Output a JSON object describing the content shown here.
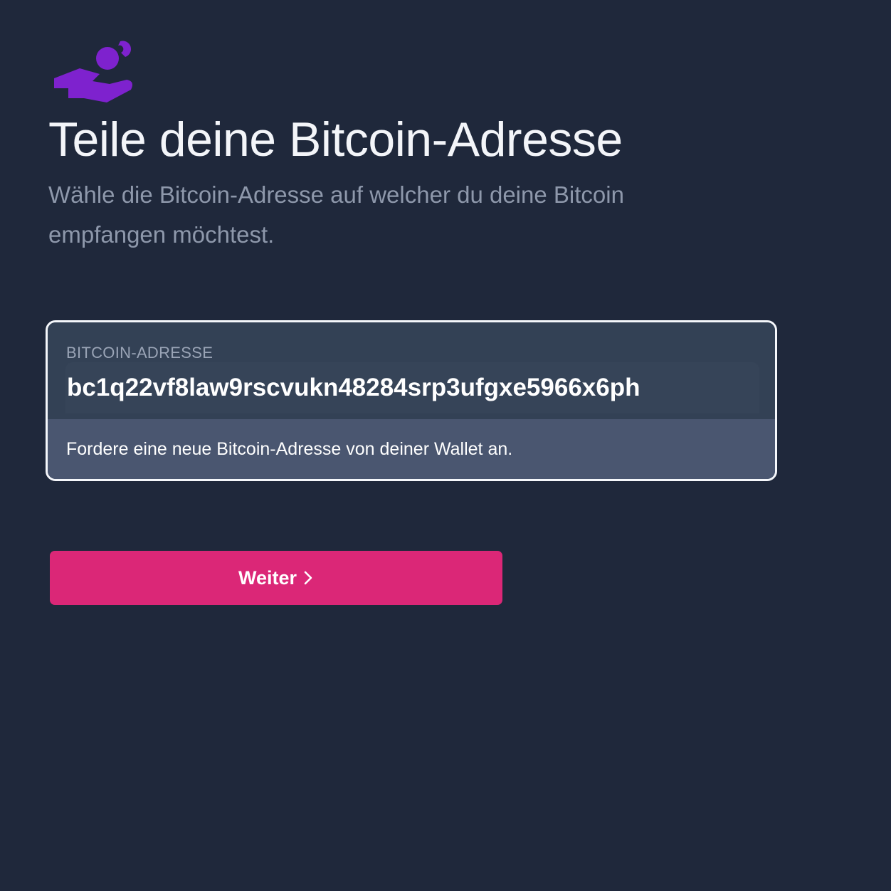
{
  "app": {
    "brand_color": "#7e22ce",
    "accent_color": "#db2777",
    "background_color": "#1f283b"
  },
  "header": {
    "logo_icon": "hand-receiving-coin-icon",
    "title": "Teile deine Bitcoin-Adresse",
    "subtitle": "Wähle die Bitcoin-Adresse auf welcher du deine Bitcoin empfangen möchtest."
  },
  "address_field": {
    "label": "BITCOIN-ADRESSE",
    "value": "bc1q22vf8law9rscvukn48284srp3ufgxe5966x6ph",
    "hint": "Fordere eine neue Bitcoin-Adresse von deiner Wallet an."
  },
  "actions": {
    "continue_label": "Weiter",
    "continue_icon": "chevron-right-icon"
  }
}
